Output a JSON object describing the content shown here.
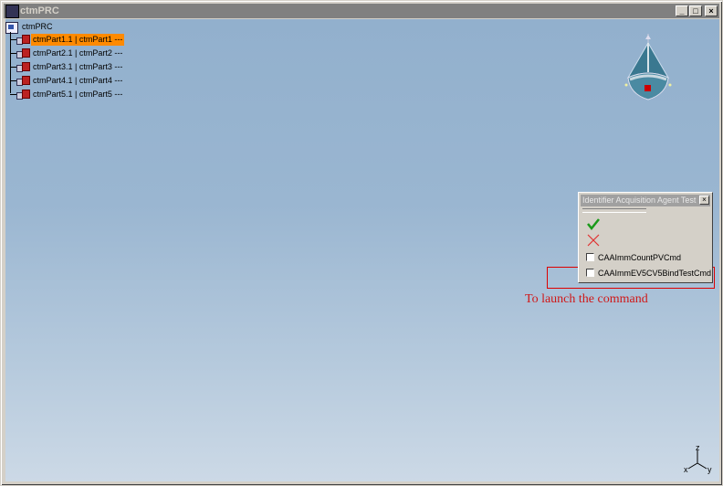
{
  "window": {
    "title": "ctmPRC",
    "buttons": {
      "minimize": "_",
      "maximize": "□",
      "close": "×"
    }
  },
  "tree": {
    "root": "ctmPRC",
    "items": [
      {
        "label": "ctmPart1.1 | ctmPart1 ---",
        "selected": true
      },
      {
        "label": "ctmPart2.1 | ctmPart2 ---",
        "selected": false
      },
      {
        "label": "ctmPart3.1 | ctmPart3 ---",
        "selected": false
      },
      {
        "label": "ctmPart4.1 | ctmPart4 ---",
        "selected": false
      },
      {
        "label": "ctmPart5.1 | ctmPart5 ---",
        "selected": false
      }
    ]
  },
  "dialog": {
    "title": "Identifier Acquisition Agent Test",
    "close": "×",
    "ok_icon": "check-icon",
    "cancel_icon": "x-icon",
    "options": [
      {
        "label": "CAAImmCountPVCmd",
        "checked": false
      },
      {
        "label": "CAAImmEV5CV5BindTestCmd",
        "checked": false
      }
    ]
  },
  "annotation": {
    "text": "To launch the command",
    "color": "#d01818"
  },
  "axis": {
    "z": "z",
    "x": "x",
    "y": "y"
  },
  "colors": {
    "selection": "#ff8a00",
    "viewport_top": "#92b0cd",
    "viewport_bottom": "#ccd9e6"
  }
}
